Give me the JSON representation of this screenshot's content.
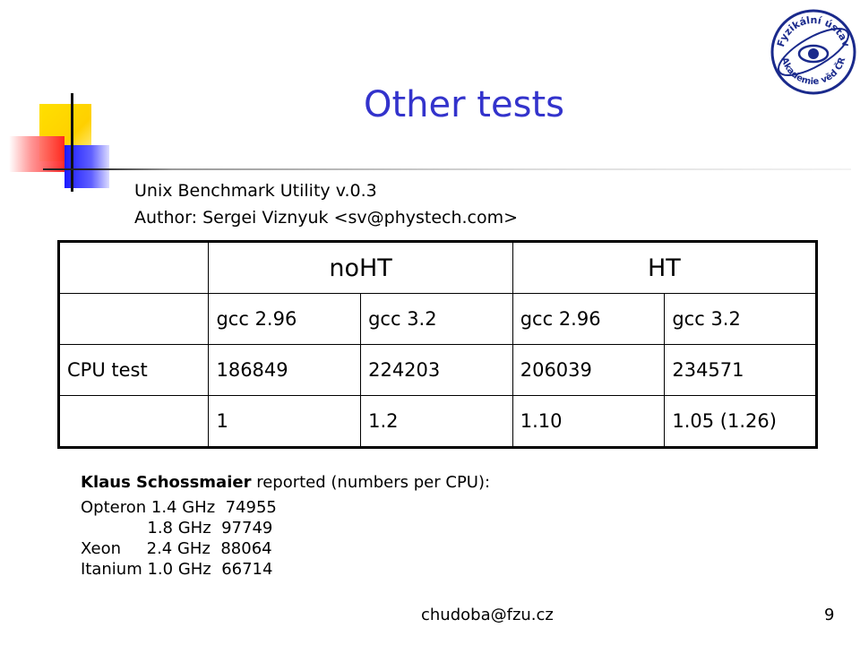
{
  "slide": {
    "title": "Other tests",
    "benchmark_name": "Unix Benchmark Utility v.0.3",
    "author_line": "Author: Sergei Viznyuk <sv@phystech.com>",
    "logo_text_top": "Fyzikální ústav",
    "logo_text_bottom": "Akademie věd ČR"
  },
  "table": {
    "group_headers": [
      "noHT",
      "HT"
    ],
    "compilers": [
      "gcc 2.96",
      "gcc 3.2",
      "gcc 2.96",
      "gcc 3.2"
    ],
    "rows": [
      {
        "label": "CPU test",
        "values": [
          "186849",
          "224203",
          "206039",
          "234571"
        ]
      },
      {
        "label": "",
        "values": [
          "1",
          "1.2",
          "1.10",
          "1.05 (1.26)"
        ]
      }
    ]
  },
  "notes": {
    "reporter": "Klaus Schossmaier",
    "reporter_suffix": " reported (numbers per CPU):",
    "lines": [
      "Opteron 1.4 GHz  74955",
      "             1.8 GHz  97749",
      "Xeon     2.4 GHz  88064",
      "Itanium 1.0 GHz  66714"
    ]
  },
  "footer": {
    "email": "chudoba@fzu.cz",
    "page_number": "9"
  }
}
